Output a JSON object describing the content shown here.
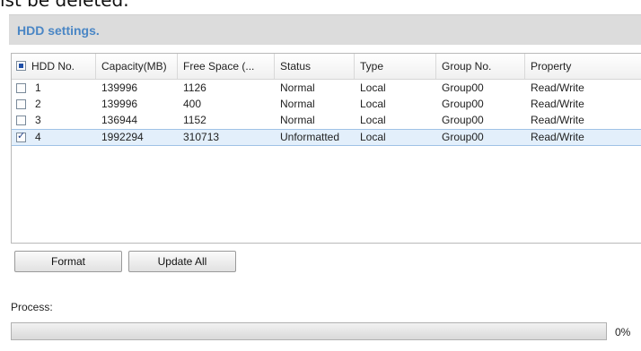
{
  "caption_fragment": "ist be deleted.",
  "panel": {
    "title": "HDD settings."
  },
  "table": {
    "headers": [
      "HDD No.",
      "Capacity(MB)",
      "Free Space (...",
      "Status",
      "Type",
      "Group No.",
      "Property"
    ],
    "select_all_state": "partial",
    "rows": [
      {
        "checked": false,
        "hdd_no": "1",
        "capacity": "139996",
        "free_space": "1126",
        "status": "Normal",
        "type": "Local",
        "group": "Group00",
        "property": "Read/Write"
      },
      {
        "checked": false,
        "hdd_no": "2",
        "capacity": "139996",
        "free_space": "400",
        "status": "Normal",
        "type": "Local",
        "group": "Group00",
        "property": "Read/Write"
      },
      {
        "checked": false,
        "hdd_no": "3",
        "capacity": "136944",
        "free_space": "1152",
        "status": "Normal",
        "type": "Local",
        "group": "Group00",
        "property": "Read/Write"
      },
      {
        "checked": true,
        "hdd_no": "4",
        "capacity": "1992294",
        "free_space": "310713",
        "status": "Unformatted",
        "type": "Local",
        "group": "Group00",
        "property": "Read/Write",
        "selected": true
      }
    ]
  },
  "buttons": {
    "format": "Format",
    "update_all": "Update All"
  },
  "process": {
    "label": "Process:",
    "value_text": "0%",
    "fraction": 0
  },
  "colors": {
    "title": "#4a86c5",
    "header_bar": "#dcdcdc",
    "selected_row": "#e3effb",
    "checkbox_mark": "#1f4fa8"
  }
}
